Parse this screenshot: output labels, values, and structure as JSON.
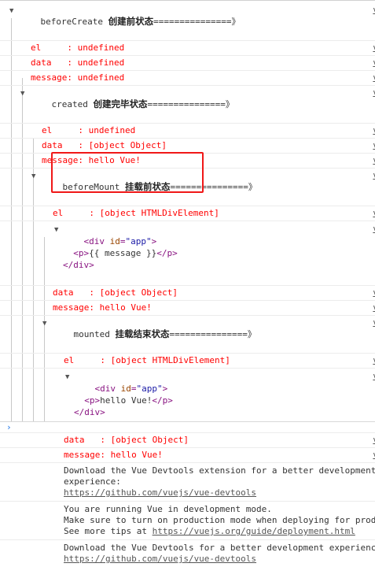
{
  "source_link": "v",
  "groups": {
    "beforeCreate": {
      "name": "beforeCreate",
      "title": "创建前状态",
      "sep": "===============》",
      "el": "el     : undefined",
      "data": "data   : undefined",
      "message": "message: undefined"
    },
    "created": {
      "name": "created",
      "title": "创建完毕状态",
      "sep": "===============》",
      "el": "el     : undefined",
      "data": "data   : [object Object]",
      "message": "message: hello Vue!"
    },
    "beforeMount": {
      "name": "beforeMount",
      "title": "挂载前状态",
      "sep": "===============》",
      "el": "el     : [object HTMLDivElement]",
      "data": "data   : [object Object]",
      "message": "message: hello Vue!",
      "dom": {
        "open": "<div",
        "attr": "id",
        "eq": "=",
        "val": "\"app\"",
        "close": ">",
        "p_open": "<p>",
        "p_text": "{{ message }}",
        "p_close": "</p>",
        "div_close": "</div>"
      }
    },
    "mounted": {
      "name": "mounted",
      "title": "挂载结束状态",
      "sep": "===============》",
      "el": "el     : [object HTMLDivElement]",
      "data": "data   : [object Object]",
      "message": "message: hello Vue!",
      "dom": {
        "open": "<div",
        "attr": "id",
        "eq": "=",
        "val": "\"app\"",
        "close": ">",
        "p_open": "<p>",
        "p_text": "hello Vue!",
        "p_close": "</p>",
        "div_close": "</div>"
      }
    }
  },
  "messages": {
    "devtools1": {
      "line1": "Download the Vue Devtools extension for a better development",
      "line2": "experience:",
      "link": "https://github.com/vuejs/vue-devtools"
    },
    "devmode": {
      "line1": "You are running Vue in development mode.",
      "line2": "Make sure to turn on production mode when deploying for production.",
      "prefix": "See more tips at ",
      "link": "https://vuejs.org/guide/deployment.html"
    },
    "devtools2": {
      "line1": "Download the Vue Devtools for a better development experience:",
      "link": "https://github.com/vuejs/vue-devtools"
    }
  },
  "prompt": "›",
  "colors": {
    "log": "#ff0000",
    "highlight_box": "#f01818",
    "tag": "#881280",
    "attr_name": "#994500",
    "attr_value": "#1a1aa6"
  }
}
